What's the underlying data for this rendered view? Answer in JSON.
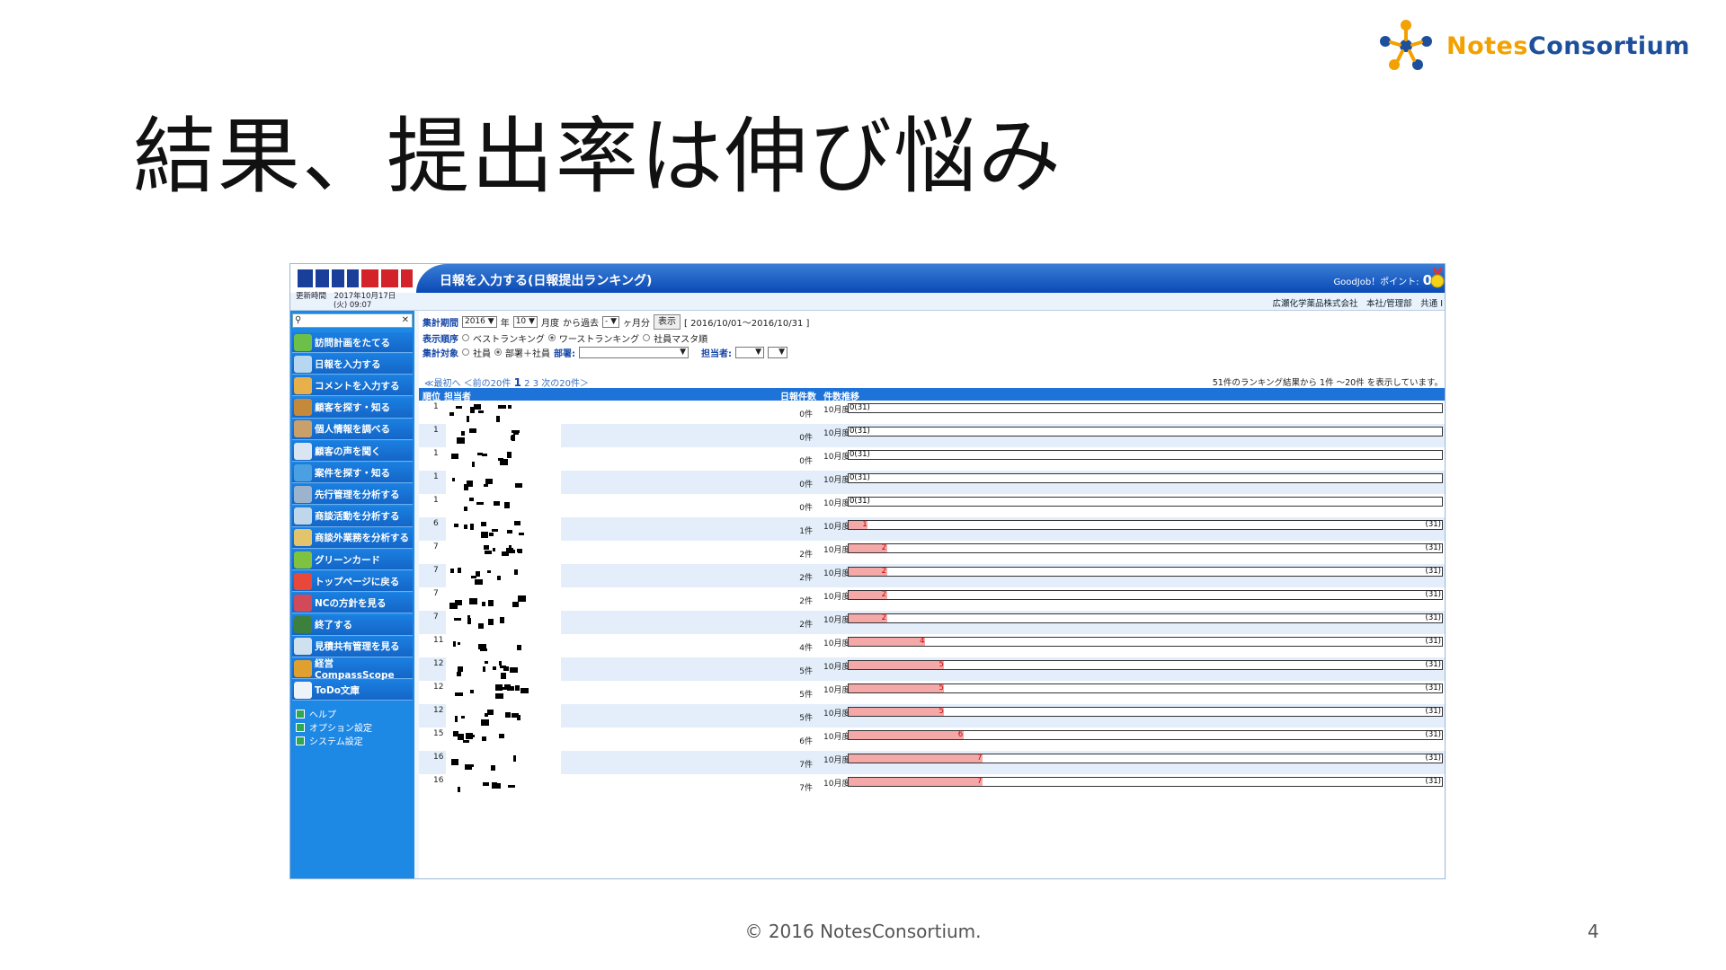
{
  "slide": {
    "title": "結果、提出率は伸び悩み",
    "logo": {
      "word1": "Notes",
      "word2": "Consortium"
    },
    "footer": "© 2016 NotesConsortium.",
    "page": "4"
  },
  "app": {
    "banner_title": "日報を入力する(日報提出ランキング)",
    "points_label": "GoodJob！ポイント:",
    "points_value": "0",
    "updated_line1": "更新時間　2017年10月17日",
    "updated_line2": "(火) 09:07",
    "company": "広瀬化学薬品株式会社　本社/管理部　共通 I",
    "search_placeholder": "",
    "sidebar": [
      {
        "label": "訪問計画をたてる",
        "icon": "calendar-icon",
        "color": "#6cc04a"
      },
      {
        "label": "日報を入力する",
        "icon": "notepad-icon",
        "color": "#b7d6ef"
      },
      {
        "label": "コメントを入力する",
        "icon": "comment-icon",
        "color": "#e8b04a"
      },
      {
        "label": "顧客を探す・知る",
        "icon": "book-icon",
        "color": "#c48a3a"
      },
      {
        "label": "個人情報を調べる",
        "icon": "person-icon",
        "color": "#caa06a"
      },
      {
        "label": "顧客の声を聞く",
        "icon": "speech-icon",
        "color": "#d9e6f2"
      },
      {
        "label": "案件を探す・知る",
        "icon": "globe-icon",
        "color": "#4aa0e0"
      },
      {
        "label": "先行管理を分析する",
        "icon": "grid-icon",
        "color": "#9bb3cc"
      },
      {
        "label": "商談活動を分析する",
        "icon": "chart-icon",
        "color": "#c0d7ea"
      },
      {
        "label": "商談外業務を分析する",
        "icon": "report-icon",
        "color": "#e3c46c"
      },
      {
        "label": "グリーンカード",
        "icon": "star-card-icon",
        "color": "#7fc241"
      },
      {
        "label": "トップページに戻る",
        "icon": "home-icon",
        "color": "#e8473a"
      },
      {
        "label": "NCの方針を見る",
        "icon": "people-icon",
        "color": "#d04a5a"
      },
      {
        "label": "終了する",
        "icon": "exit-icon",
        "color": "#3d7f3d"
      },
      {
        "label": "見積共有管理を見る",
        "icon": "table-icon",
        "color": "#cfe0ef"
      },
      {
        "label": "経営CompassScope",
        "icon": "compass-icon",
        "color": "#e0a030"
      },
      {
        "label": "ToDo文庫",
        "icon": "todo-icon",
        "color": "#eef3f8"
      }
    ],
    "sidebar_links": [
      "ヘルプ",
      "オプション設定",
      "システム設定"
    ],
    "filters": {
      "period_label": "集計期間",
      "year": "2016",
      "year_suffix": "年",
      "month": "10",
      "month_suffix": "月度",
      "from_past": "から過去",
      "span": "-",
      "span_suffix": "ヶ月分",
      "show_button": "表示",
      "range_text": "[ 2016/10/01～2016/10/31 ]",
      "order_label": "表示順序",
      "order_options": [
        "ベストランキング",
        "ワーストランキング",
        "社員マスタ順"
      ],
      "order_selected": 1,
      "target_label": "集計対象",
      "target_options": [
        "社員",
        "部署＋社員"
      ],
      "target_selected": 1,
      "dept_label": "部署:",
      "dept_value": "",
      "person_label": "担当者:",
      "person_value": ""
    },
    "pager": {
      "first": "≪最初へ",
      "prev": "＜前の20件",
      "pages": [
        "1",
        "2",
        "3"
      ],
      "current": "1",
      "next": "次の20件＞"
    },
    "count_note": "51件のランキング結果から 1件 ～20件 を表示しています。",
    "columns": {
      "rank": "順位",
      "person": "担当者",
      "count": "日報件数",
      "trend": "件数推移"
    },
    "total": 31,
    "rows": [
      {
        "rank": "1",
        "count": "0件",
        "month": "10月度",
        "value": 0
      },
      {
        "rank": "1",
        "count": "0件",
        "month": "10月度",
        "value": 0
      },
      {
        "rank": "1",
        "count": "0件",
        "month": "10月度",
        "value": 0
      },
      {
        "rank": "1",
        "count": "0件",
        "month": "10月度",
        "value": 0
      },
      {
        "rank": "1",
        "count": "0件",
        "month": "10月度",
        "value": 0
      },
      {
        "rank": "6",
        "count": "1件",
        "month": "10月度",
        "value": 1
      },
      {
        "rank": "7",
        "count": "2件",
        "month": "10月度",
        "value": 2
      },
      {
        "rank": "7",
        "count": "2件",
        "month": "10月度",
        "value": 2
      },
      {
        "rank": "7",
        "count": "2件",
        "month": "10月度",
        "value": 2
      },
      {
        "rank": "7",
        "count": "2件",
        "month": "10月度",
        "value": 2
      },
      {
        "rank": "11",
        "count": "4件",
        "month": "10月度",
        "value": 4
      },
      {
        "rank": "12",
        "count": "5件",
        "month": "10月度",
        "value": 5
      },
      {
        "rank": "12",
        "count": "5件",
        "month": "10月度",
        "value": 5
      },
      {
        "rank": "12",
        "count": "5件",
        "month": "10月度",
        "value": 5
      },
      {
        "rank": "15",
        "count": "6件",
        "month": "10月度",
        "value": 6
      },
      {
        "rank": "16",
        "count": "7件",
        "month": "10月度",
        "value": 7
      },
      {
        "rank": "16",
        "count": "7件",
        "month": "10月度",
        "value": 7
      }
    ]
  }
}
